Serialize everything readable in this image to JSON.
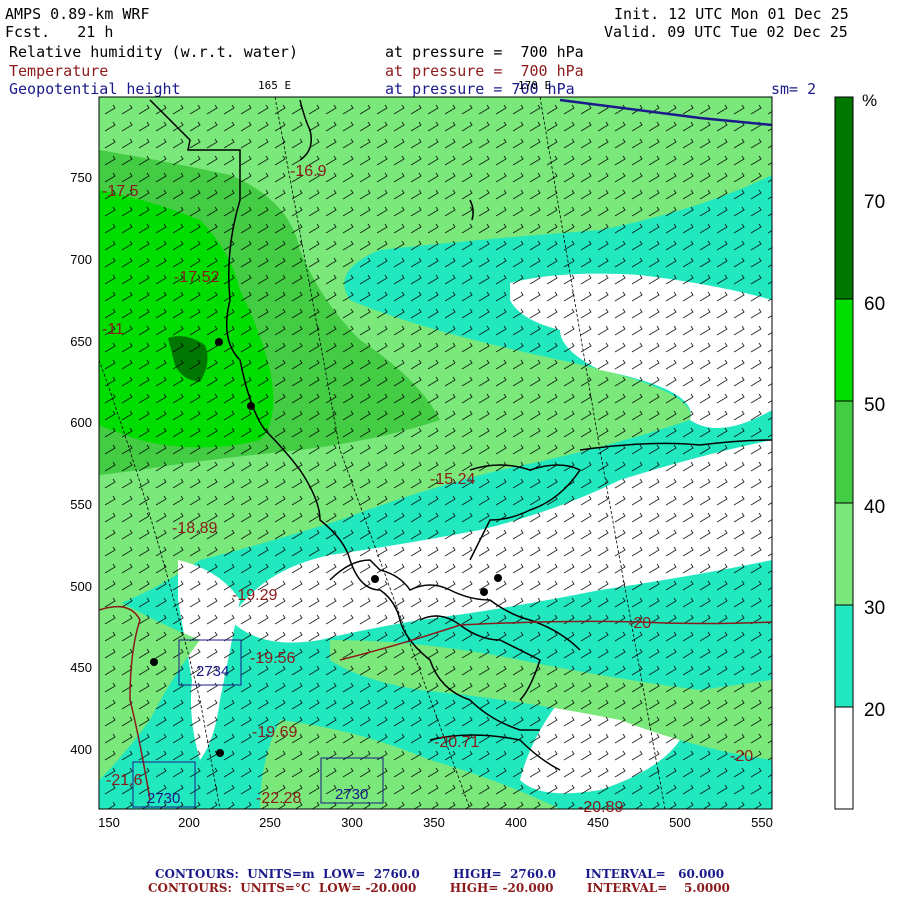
{
  "header": {
    "model": "AMPS 0.89-km WRF",
    "fcst": "Fcst.   21 h",
    "init": "Init. 12 UTC Mon 01 Dec 25",
    "valid": "Valid. 09 UTC Tue 02 Dec 25",
    "fields": [
      {
        "name": "Relative humidity (w.r.t. water)",
        "level": "at pressure =  700 hPa",
        "color": "#000000"
      },
      {
        "name": "Temperature",
        "level": "at pressure =  700 hPa",
        "color": "#8b1a1a"
      },
      {
        "name": "Geopotential height",
        "level": "at pressure = 700 hPa",
        "color": "#1a1a8b"
      }
    ],
    "lon_label_1": "165 E",
    "lon_label_2": "170 E",
    "smoothing": "sm= 2"
  },
  "axes": {
    "x_ticks": [
      "150",
      "200",
      "250",
      "300",
      "350",
      "400",
      "450",
      "500",
      "550"
    ],
    "y_ticks": [
      "750",
      "700",
      "650",
      "600",
      "550",
      "500",
      "450",
      "400"
    ]
  },
  "colorbar": {
    "unit": "%",
    "labels": [
      "70",
      "60",
      "50",
      "40",
      "30",
      "20"
    ],
    "colors": [
      "#ffffff",
      "#22e8c0",
      "#7ae87a",
      "#44cc44",
      "#00dd00",
      "#007700"
    ]
  },
  "temperature_labels": [
    {
      "text": "-16.9"
    },
    {
      "text": "-17.52"
    },
    {
      "text": "-18.89"
    },
    {
      "text": "-19.29"
    },
    {
      "text": "-19.56"
    },
    {
      "text": "-19.69"
    },
    {
      "text": "-15.24"
    },
    {
      "text": "-20.71"
    },
    {
      "text": "-20"
    },
    {
      "text": "-20"
    },
    {
      "text": "-21.6"
    },
    {
      "text": "-22.28"
    },
    {
      "text": "-20.89"
    },
    {
      "text": "-17.5"
    },
    {
      "text": "-11"
    }
  ],
  "height_labels": [
    {
      "text": "2734"
    },
    {
      "text": "2730"
    },
    {
      "text": "2730"
    }
  ],
  "footer": {
    "line1": "CONTOURS:  UNITS=m  LOW=  2760.0        HIGH=  2760.0       INTERVAL=   60.000",
    "line2": "CONTOURS:  UNITS=°C  LOW= -20.000        HIGH= -20.000        INTERVAL=    5.0000"
  }
}
